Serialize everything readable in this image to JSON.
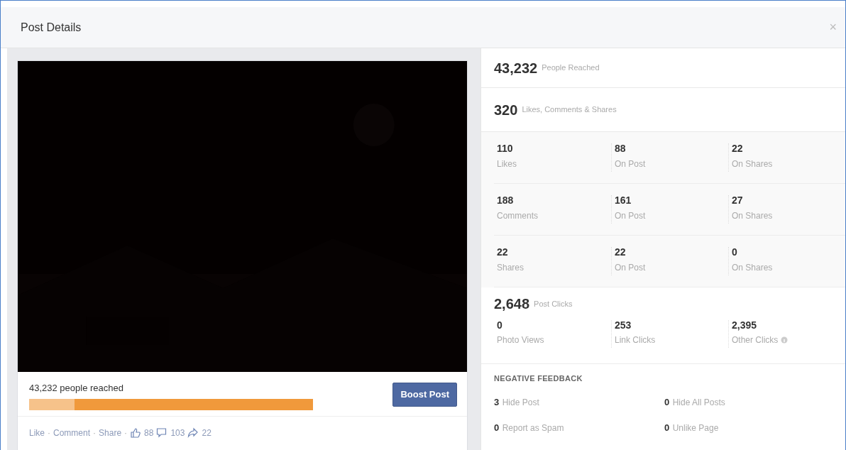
{
  "window": {
    "title": "Post Details",
    "close": "×"
  },
  "post": {
    "reach_text": "43,232 people reached",
    "reach_bar": [
      {
        "kind": "paid",
        "level": 0.16
      },
      {
        "kind": "organic",
        "level": 0.84
      }
    ],
    "boost_button": "Boost Post",
    "actions": [
      {
        "label": "Like",
        "separator": "·"
      },
      {
        "label": "Comment",
        "separator": "·"
      },
      {
        "label": "Share",
        "separator": "·"
      }
    ],
    "counts": [
      {
        "kind": "likes",
        "value": "88"
      },
      {
        "kind": "comments",
        "value": "103"
      },
      {
        "kind": "shares",
        "value": "22"
      }
    ]
  },
  "summary": [
    {
      "value": "43,232",
      "label": "People Reached"
    },
    {
      "value": "320",
      "label": "Likes, Comments & Shares"
    }
  ],
  "engagement": [
    [
      {
        "value": "110",
        "label": "Likes"
      },
      {
        "value": "88",
        "label": "On Post"
      },
      {
        "value": "22",
        "label": "On Shares"
      }
    ],
    [
      {
        "value": "188",
        "label": "Comments"
      },
      {
        "value": "161",
        "label": "On Post"
      },
      {
        "value": "27",
        "label": "On Shares"
      }
    ],
    [
      {
        "value": "22",
        "label": "Shares"
      },
      {
        "value": "22",
        "label": "On Post"
      },
      {
        "value": "0",
        "label": "On Shares"
      }
    ]
  ],
  "clicks": {
    "value": "2,648",
    "label": "Post Clicks",
    "items": [
      {
        "value": "0",
        "label": "Photo Views",
        "info": false
      },
      {
        "value": "253",
        "label": "Link Clicks",
        "info": false
      },
      {
        "value": "2,395",
        "label": "Other Clicks",
        "info": true
      }
    ]
  },
  "negative_feedback": {
    "title": "NEGATIVE FEEDBACK",
    "items": [
      {
        "value": "3",
        "label": "Hide Post"
      },
      {
        "value": "0",
        "label": "Hide All Posts"
      },
      {
        "value": "0",
        "label": "Report as Spam"
      },
      {
        "value": "0",
        "label": "Unlike Page"
      }
    ]
  }
}
